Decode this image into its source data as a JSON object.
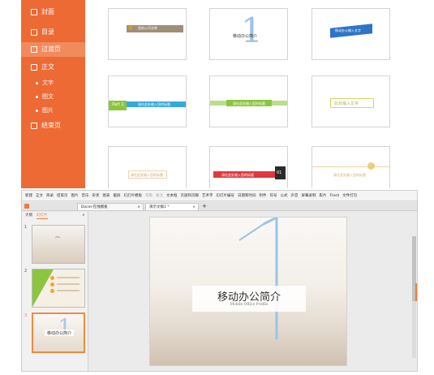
{
  "sidebar": {
    "items": [
      {
        "label": "封面",
        "type": "main"
      },
      {
        "label": "目录",
        "type": "main"
      },
      {
        "label": "过渡页",
        "type": "main",
        "active": true
      },
      {
        "label": "正文",
        "type": "main"
      },
      {
        "label": "文字",
        "type": "sub"
      },
      {
        "label": "图文",
        "type": "sub"
      },
      {
        "label": "图片",
        "type": "sub"
      },
      {
        "label": "结束页",
        "type": "main"
      }
    ]
  },
  "templates": {
    "row1": [
      {
        "caption": "您的公司名称"
      },
      {
        "caption": "移动办公简介"
      },
      {
        "caption": "移动办公输入文字"
      }
    ],
    "row2": [
      {
        "tag": "Part 1",
        "caption": "请在此处输入您的标题"
      },
      {
        "caption": "请在此处输入您的标题"
      },
      {
        "caption": "此处输入文字"
      }
    ],
    "row3": [
      {
        "caption": "请在此处输入您的标题"
      },
      {
        "tag": "01",
        "caption": "请在此处输入您的标题"
      },
      {
        "caption": "请在此处输入您的标题"
      }
    ]
  },
  "editor": {
    "menu": [
      "新建",
      "正文",
      "目录",
      "结束页",
      "图片",
      "音乐",
      "形状",
      "图表",
      "截屏",
      "幻灯片模板",
      "母版",
      "备注",
      "文本框",
      "页眉和页脚",
      "艺术字",
      "幻灯片编号",
      "日期和时间",
      "附件",
      "符号",
      "公式",
      "声音",
      "屏幕录制",
      "影片",
      "Flash",
      "文件打包"
    ],
    "tabs": [
      {
        "label": "Docer-在线模板"
      },
      {
        "label": "演示文稿1 *",
        "active": true
      }
    ],
    "panel_tabs": [
      "大纲",
      "幻灯片"
    ],
    "slide_numbers": [
      "1",
      "2",
      "3"
    ],
    "slide": {
      "title": "移动办公简介",
      "subtitle": "Mobile Office Profile",
      "big_numeral": "1"
    }
  },
  "colors": {
    "sidebar": "#ee6a34",
    "accent_blue": "#2f74c6",
    "accent_green": "#8cc63f",
    "accent_orange": "#ef7b39"
  }
}
